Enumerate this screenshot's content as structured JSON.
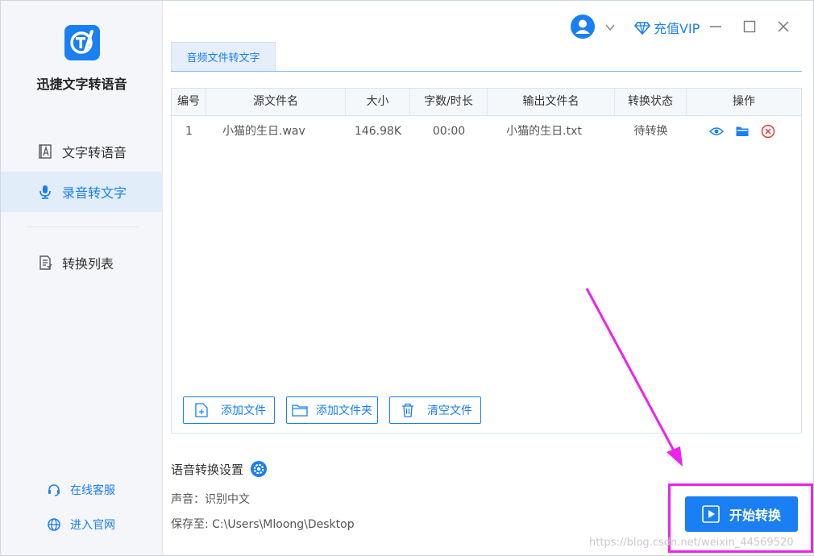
{
  "app": {
    "name": "迅捷文字转语音"
  },
  "sidebar": {
    "items": [
      {
        "label": "文字转语音",
        "icon": "text-to-speech-icon",
        "active": false
      },
      {
        "label": "录音转文字",
        "icon": "microphone-icon",
        "active": true
      },
      {
        "label": "转换列表",
        "icon": "list-doc-icon",
        "active": false
      }
    ],
    "links": [
      {
        "label": "在线客服",
        "icon": "headset-icon"
      },
      {
        "label": "进入官网",
        "icon": "globe-icon"
      }
    ]
  },
  "titlebar": {
    "vip_label": "充值VIP",
    "icons": [
      "user-icon",
      "chevron-down-icon",
      "diamond-icon",
      "minimize-icon",
      "maximize-icon",
      "close-icon"
    ]
  },
  "tab": {
    "label": "音频文件转文字"
  },
  "table": {
    "columns": [
      "编号",
      "源文件名",
      "大小",
      "字数/时长",
      "输出文件名",
      "转换状态",
      "操作"
    ],
    "rows": [
      {
        "index": "1",
        "source": "小猫的生日.wav",
        "size": "146.98K",
        "duration": "00:00",
        "output": "小猫的生日.txt",
        "status": "待转换",
        "actions": [
          "eye-icon",
          "folder-icon",
          "delete-icon"
        ]
      }
    ]
  },
  "buttons": {
    "add_file": "添加文件",
    "add_folder": "添加文件夹",
    "clear_files": "清空文件",
    "start": "开始转换"
  },
  "settings": {
    "title": "语音转换设置",
    "voice": "声音：识别中文",
    "save_to": "保存至: C:\\Users\\Mloong\\Desktop"
  },
  "watermark": "https://blog.csdn.net/weixin_44569520",
  "colors": {
    "accent": "#1a7ff2",
    "highlight": "#ee22ee",
    "delete": "#e83a3a"
  }
}
